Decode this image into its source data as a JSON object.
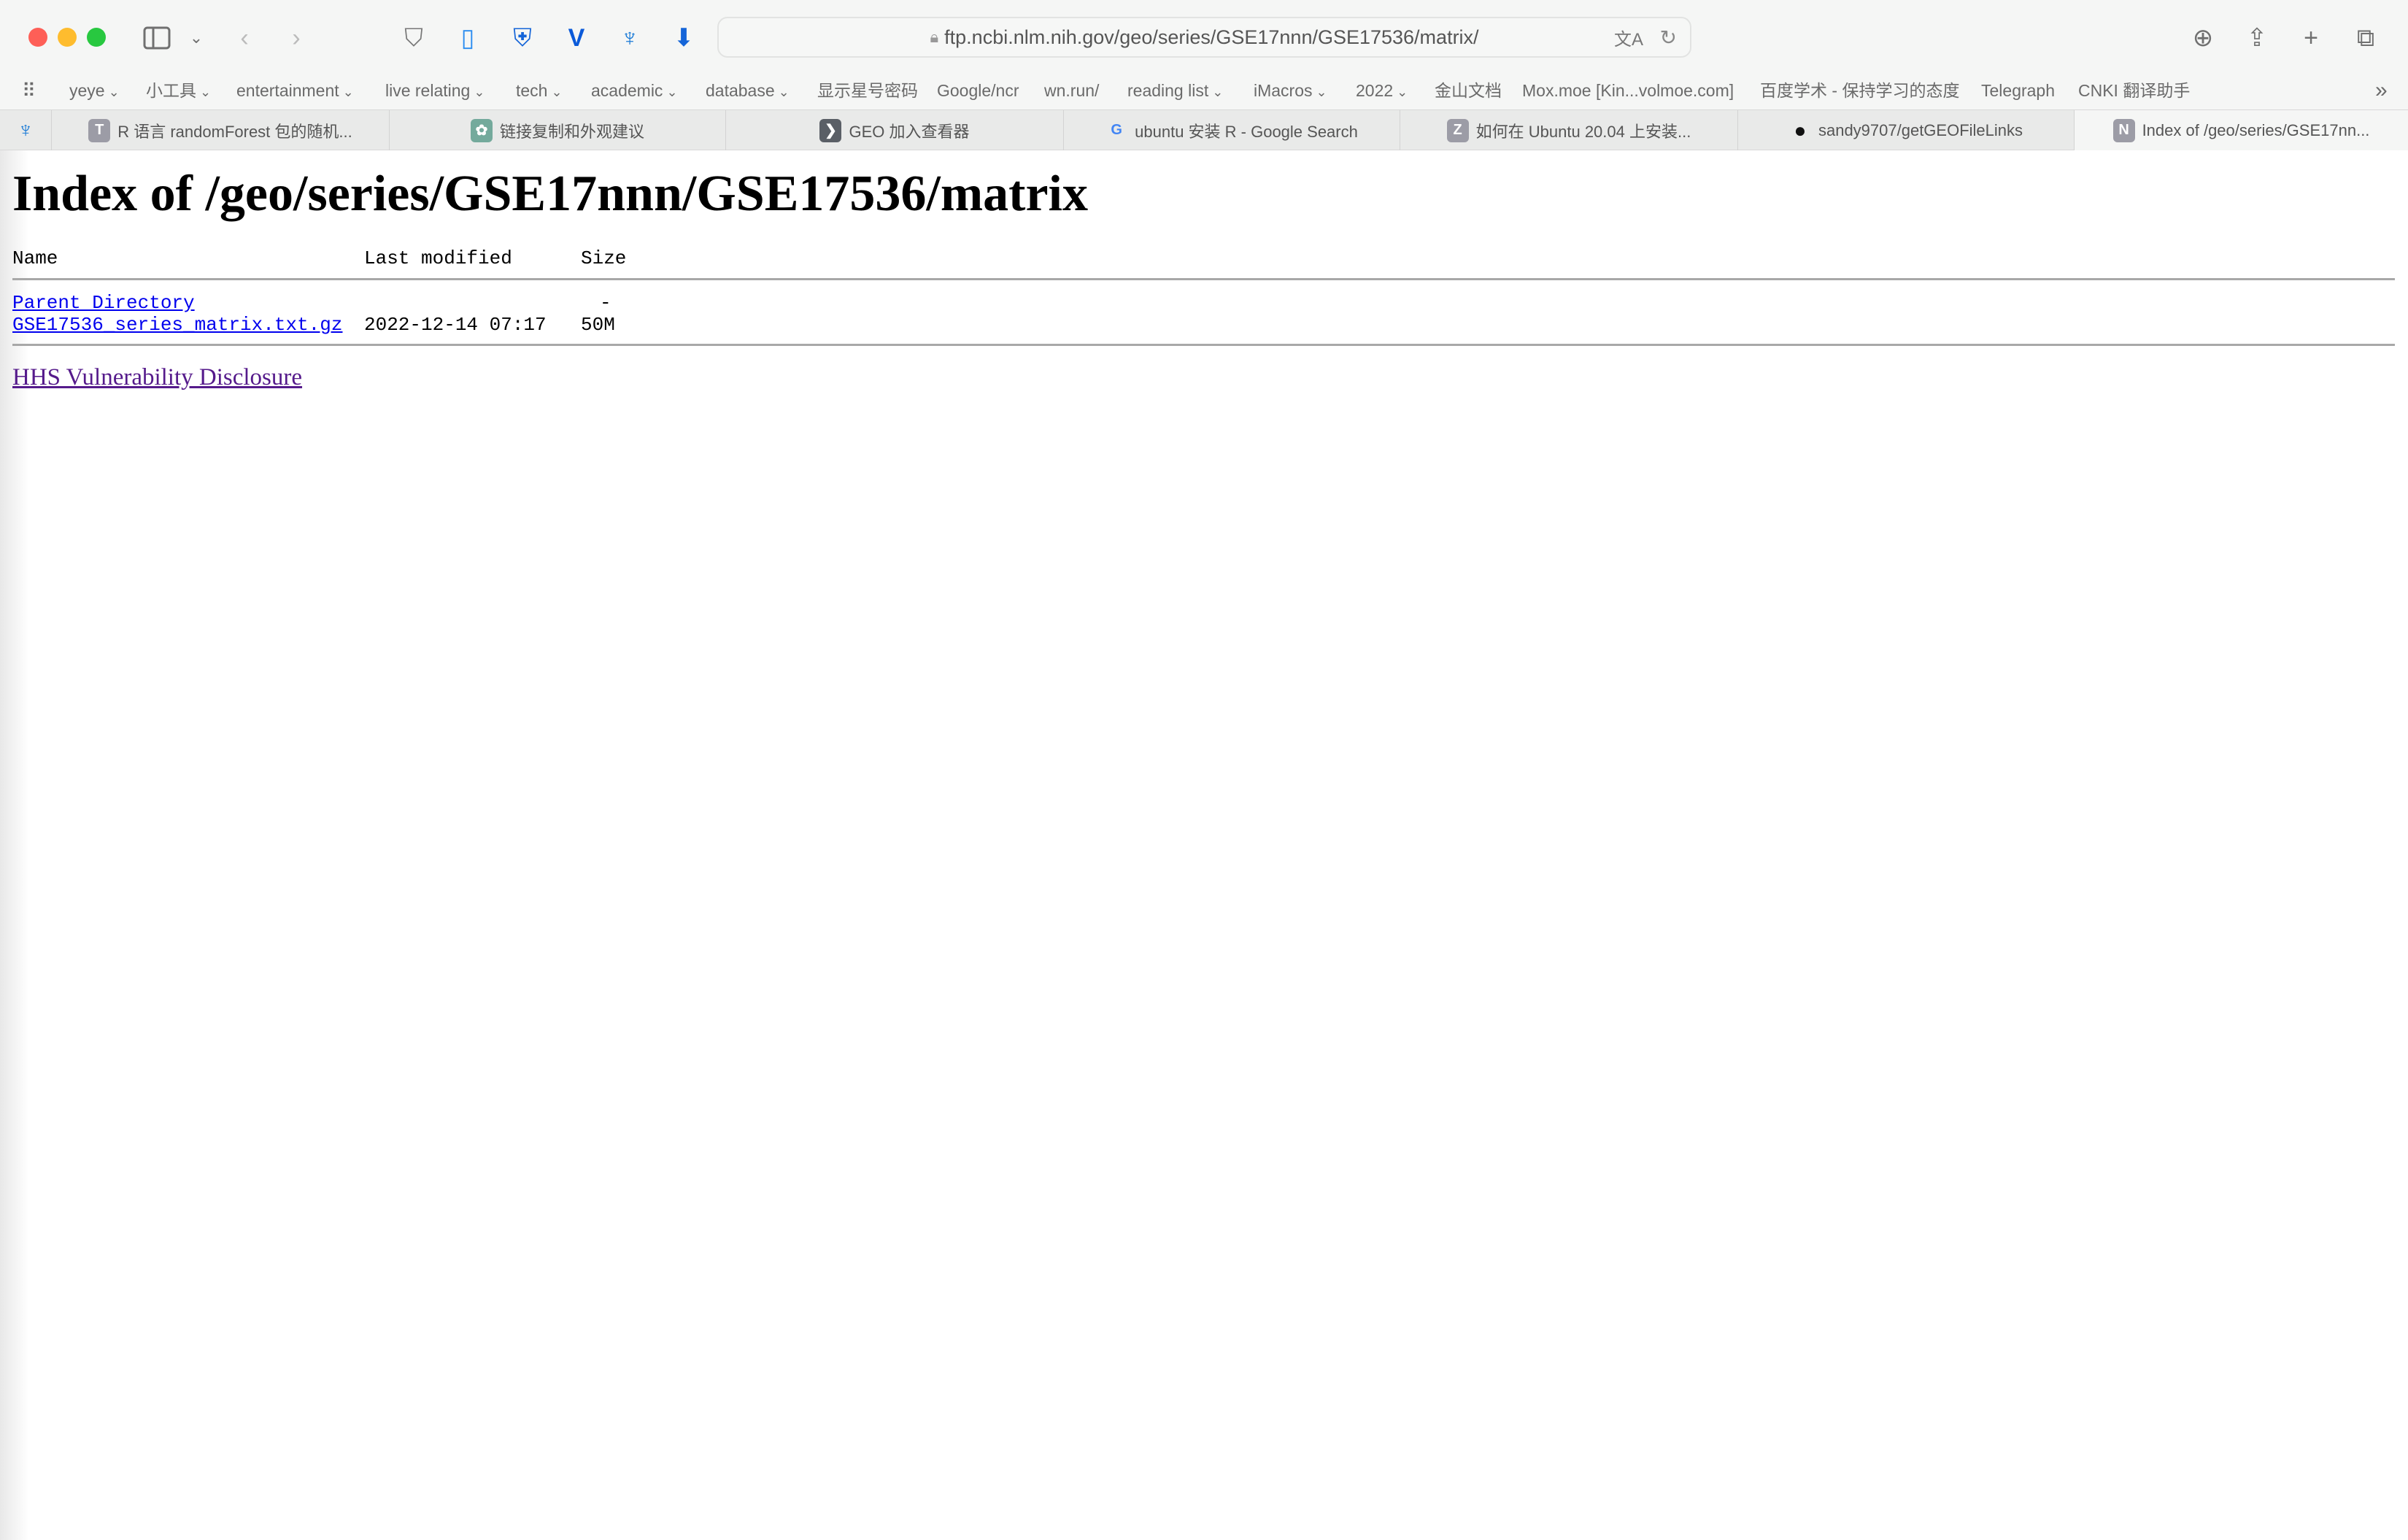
{
  "browser": {
    "url": "ftp.ncbi.nlm.nih.gov/geo/series/GSE17nnn/GSE17536/matrix/",
    "bookmarks": [
      "yeye",
      "小工具",
      "entertainment",
      "live relating",
      "tech",
      "academic",
      "database",
      "显示星号密码",
      "Google/ncr",
      "wn.run/",
      "reading list",
      "iMacros",
      "2022",
      "金山文档",
      "Mox.moe [Kin...volmoe.com]",
      "百度学术 - 保持学习的态度",
      "Telegraph",
      "CNKI 翻译助手"
    ],
    "bookmark_dropdowns": [
      true,
      true,
      true,
      true,
      true,
      true,
      true,
      false,
      false,
      false,
      true,
      true,
      true,
      false,
      false,
      false,
      false,
      false
    ],
    "tabs": [
      {
        "label": "R 语言 randomForest 包的随机...",
        "icon": "T",
        "color": "#9c9ca6"
      },
      {
        "label": "链接复制和外观建议",
        "icon": "chatgpt",
        "color": "#74aa9c"
      },
      {
        "label": "GEO 加入查看器",
        "icon": "geo",
        "color": "#5a5f66"
      },
      {
        "label": "ubuntu 安装 R - Google Search",
        "icon": "google",
        "color": "#4285f4"
      },
      {
        "label": "如何在 Ubuntu 20.04 上安装...",
        "icon": "Z",
        "color": "#9c9ca6"
      },
      {
        "label": "sandy9707/getGEOFileLinks",
        "icon": "github",
        "color": "#111111"
      },
      {
        "label": "Index of /geo/series/GSE17nn...",
        "icon": "N",
        "color": "#9c9ca6",
        "active": true
      }
    ]
  },
  "page": {
    "title": "Index of /geo/series/GSE17nnn/GSE17536/matrix",
    "columns": {
      "name": "Name",
      "modified": "Last modified",
      "size": "Size"
    },
    "rows": [
      {
        "name": "Parent Directory",
        "modified": "",
        "size": "-"
      },
      {
        "name": "GSE17536_series_matrix.txt.gz",
        "modified": "2022-12-14 07:17",
        "size": "50M"
      }
    ],
    "footer_link": "HHS Vulnerability Disclosure"
  },
  "colors": {
    "link": "#0000ee",
    "visited": "#551a8b"
  }
}
